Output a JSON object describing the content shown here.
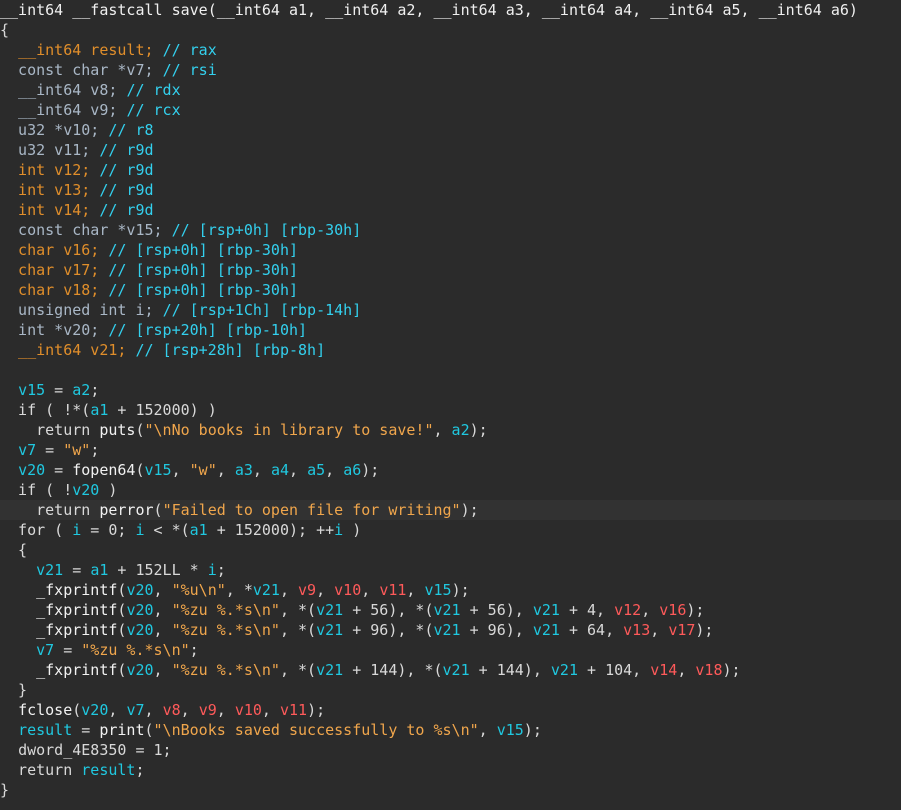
{
  "colors": {
    "background": "#2b2b2b",
    "current_line": "#323232",
    "type_orange": "#e08e2b",
    "identifier_cyan": "#20c8e0",
    "string_orange": "#f0a64c",
    "red_variable": "#ff5a5a",
    "default_text": "#d9d9d9"
  },
  "lines": [
    [
      {
        "t": "__int64 __fastcall save(__int64 a1, __int64 a2, __int64 a3, __int64 a4, __int64 a5, __int64 a6)",
        "c": "sig"
      }
    ],
    [
      {
        "t": "{",
        "c": "plain"
      }
    ],
    [
      {
        "t": "  ",
        "c": "plain"
      },
      {
        "t": "__int64",
        "c": "type"
      },
      {
        "t": " result; ",
        "c": "type"
      },
      {
        "t": "// rax",
        "c": "comment"
      }
    ],
    [
      {
        "t": "  const char *v7; ",
        "c": "keyword"
      },
      {
        "t": "// rsi",
        "c": "comment"
      }
    ],
    [
      {
        "t": "  __int64 v8; ",
        "c": "keyword"
      },
      {
        "t": "// rdx",
        "c": "comment"
      }
    ],
    [
      {
        "t": "  __int64 v9; ",
        "c": "keyword"
      },
      {
        "t": "// rcx",
        "c": "comment"
      }
    ],
    [
      {
        "t": "  u32 *v10; ",
        "c": "keyword"
      },
      {
        "t": "// r8",
        "c": "comment"
      }
    ],
    [
      {
        "t": "  u32 v11; ",
        "c": "keyword"
      },
      {
        "t": "// r9d",
        "c": "comment"
      }
    ],
    [
      {
        "t": "  int v12; ",
        "c": "type"
      },
      {
        "t": "// r9d",
        "c": "comment"
      }
    ],
    [
      {
        "t": "  int v13; ",
        "c": "type"
      },
      {
        "t": "// r9d",
        "c": "comment"
      }
    ],
    [
      {
        "t": "  int v14; ",
        "c": "type"
      },
      {
        "t": "// r9d",
        "c": "comment"
      }
    ],
    [
      {
        "t": "  const char *v15; ",
        "c": "keyword"
      },
      {
        "t": "// [rsp+0h] [rbp-30h]",
        "c": "comment"
      }
    ],
    [
      {
        "t": "  char v16; ",
        "c": "type"
      },
      {
        "t": "// [rsp+0h] [rbp-30h]",
        "c": "comment"
      }
    ],
    [
      {
        "t": "  char v17; ",
        "c": "type"
      },
      {
        "t": "// [rsp+0h] [rbp-30h]",
        "c": "comment"
      }
    ],
    [
      {
        "t": "  char v18; ",
        "c": "type"
      },
      {
        "t": "// [rsp+0h] [rbp-30h]",
        "c": "comment"
      }
    ],
    [
      {
        "t": "  unsigned int i; ",
        "c": "keyword"
      },
      {
        "t": "// [rsp+1Ch] [rbp-14h]",
        "c": "comment"
      }
    ],
    [
      {
        "t": "  int *v20; ",
        "c": "keyword"
      },
      {
        "t": "// [rsp+20h] [rbp-10h]",
        "c": "comment"
      }
    ],
    [
      {
        "t": "  __int64 v21; ",
        "c": "type"
      },
      {
        "t": "// [rsp+28h] [rbp-8h]",
        "c": "comment"
      }
    ],
    [
      {
        "t": "",
        "c": "plain"
      }
    ],
    [
      {
        "t": "  ",
        "c": "plain"
      },
      {
        "t": "v15",
        "c": "ident"
      },
      {
        "t": " = ",
        "c": "plain"
      },
      {
        "t": "a2",
        "c": "ident"
      },
      {
        "t": ";",
        "c": "plain"
      }
    ],
    [
      {
        "t": "  if ( !*(",
        "c": "plain"
      },
      {
        "t": "a1",
        "c": "ident"
      },
      {
        "t": " + 152000) )",
        "c": "plain"
      }
    ],
    [
      {
        "t": "    return ",
        "c": "plain"
      },
      {
        "t": "puts",
        "c": "func"
      },
      {
        "t": "(",
        "c": "plain"
      },
      {
        "t": "\"\\nNo books in library to save!\"",
        "c": "string"
      },
      {
        "t": ", ",
        "c": "plain"
      },
      {
        "t": "a2",
        "c": "ident"
      },
      {
        "t": ");",
        "c": "plain"
      }
    ],
    [
      {
        "t": "  ",
        "c": "plain"
      },
      {
        "t": "v7",
        "c": "ident"
      },
      {
        "t": " = ",
        "c": "plain"
      },
      {
        "t": "\"w\"",
        "c": "string"
      },
      {
        "t": ";",
        "c": "plain"
      }
    ],
    [
      {
        "t": "  ",
        "c": "plain"
      },
      {
        "t": "v20",
        "c": "ident"
      },
      {
        "t": " = ",
        "c": "plain"
      },
      {
        "t": "fopen64",
        "c": "func"
      },
      {
        "t": "(",
        "c": "plain"
      },
      {
        "t": "v15",
        "c": "ident"
      },
      {
        "t": ", ",
        "c": "plain"
      },
      {
        "t": "\"w\"",
        "c": "string"
      },
      {
        "t": ", ",
        "c": "plain"
      },
      {
        "t": "a3",
        "c": "ident"
      },
      {
        "t": ", ",
        "c": "plain"
      },
      {
        "t": "a4",
        "c": "ident"
      },
      {
        "t": ", ",
        "c": "plain"
      },
      {
        "t": "a5",
        "c": "ident"
      },
      {
        "t": ", ",
        "c": "plain"
      },
      {
        "t": "a6",
        "c": "ident"
      },
      {
        "t": ");",
        "c": "plain"
      }
    ],
    [
      {
        "t": "  if ( !",
        "c": "plain"
      },
      {
        "t": "v20",
        "c": "ident"
      },
      {
        "t": " )",
        "c": "plain"
      }
    ],
    [
      {
        "t": "    return ",
        "c": "plain"
      },
      {
        "t": "perror",
        "c": "func"
      },
      {
        "t": "(",
        "c": "plain"
      },
      {
        "t": "\"Failed to open file for writing\"",
        "c": "string"
      },
      {
        "t": ");",
        "c": "plain"
      }
    ],
    [
      {
        "t": "  for ( ",
        "c": "plain"
      },
      {
        "t": "i",
        "c": "ident"
      },
      {
        "t": " = 0; ",
        "c": "plain"
      },
      {
        "t": "i",
        "c": "ident"
      },
      {
        "t": " < *(",
        "c": "plain"
      },
      {
        "t": "a1",
        "c": "ident"
      },
      {
        "t": " + 152000); ++",
        "c": "plain"
      },
      {
        "t": "i",
        "c": "ident"
      },
      {
        "t": " )",
        "c": "plain"
      }
    ],
    [
      {
        "t": "  {",
        "c": "plain"
      }
    ],
    [
      {
        "t": "    ",
        "c": "plain"
      },
      {
        "t": "v21",
        "c": "ident"
      },
      {
        "t": " = ",
        "c": "plain"
      },
      {
        "t": "a1",
        "c": "ident"
      },
      {
        "t": " + 152LL * ",
        "c": "plain"
      },
      {
        "t": "i",
        "c": "ident"
      },
      {
        "t": ";",
        "c": "plain"
      }
    ],
    [
      {
        "t": "    ",
        "c": "plain"
      },
      {
        "t": "_fxprintf",
        "c": "func"
      },
      {
        "t": "(",
        "c": "plain"
      },
      {
        "t": "v20",
        "c": "ident"
      },
      {
        "t": ", ",
        "c": "plain"
      },
      {
        "t": "\"%u\\n\"",
        "c": "string"
      },
      {
        "t": ", *",
        "c": "plain"
      },
      {
        "t": "v21",
        "c": "ident"
      },
      {
        "t": ", ",
        "c": "plain"
      },
      {
        "t": "v9",
        "c": "red"
      },
      {
        "t": ", ",
        "c": "plain"
      },
      {
        "t": "v10",
        "c": "red"
      },
      {
        "t": ", ",
        "c": "plain"
      },
      {
        "t": "v11",
        "c": "red"
      },
      {
        "t": ", ",
        "c": "plain"
      },
      {
        "t": "v15",
        "c": "ident"
      },
      {
        "t": ");",
        "c": "plain"
      }
    ],
    [
      {
        "t": "    ",
        "c": "plain"
      },
      {
        "t": "_fxprintf",
        "c": "func"
      },
      {
        "t": "(",
        "c": "plain"
      },
      {
        "t": "v20",
        "c": "ident"
      },
      {
        "t": ", ",
        "c": "plain"
      },
      {
        "t": "\"%zu %.*s\\n\"",
        "c": "string"
      },
      {
        "t": ", *(",
        "c": "plain"
      },
      {
        "t": "v21",
        "c": "ident"
      },
      {
        "t": " + 56), *(",
        "c": "plain"
      },
      {
        "t": "v21",
        "c": "ident"
      },
      {
        "t": " + 56), ",
        "c": "plain"
      },
      {
        "t": "v21",
        "c": "ident"
      },
      {
        "t": " + 4, ",
        "c": "plain"
      },
      {
        "t": "v12",
        "c": "red"
      },
      {
        "t": ", ",
        "c": "plain"
      },
      {
        "t": "v16",
        "c": "red"
      },
      {
        "t": ");",
        "c": "plain"
      }
    ],
    [
      {
        "t": "    ",
        "c": "plain"
      },
      {
        "t": "_fxprintf",
        "c": "func"
      },
      {
        "t": "(",
        "c": "plain"
      },
      {
        "t": "v20",
        "c": "ident"
      },
      {
        "t": ", ",
        "c": "plain"
      },
      {
        "t": "\"%zu %.*s\\n\"",
        "c": "string"
      },
      {
        "t": ", *(",
        "c": "plain"
      },
      {
        "t": "v21",
        "c": "ident"
      },
      {
        "t": " + 96), *(",
        "c": "plain"
      },
      {
        "t": "v21",
        "c": "ident"
      },
      {
        "t": " + 96), ",
        "c": "plain"
      },
      {
        "t": "v21",
        "c": "ident"
      },
      {
        "t": " + 64, ",
        "c": "plain"
      },
      {
        "t": "v13",
        "c": "red"
      },
      {
        "t": ", ",
        "c": "plain"
      },
      {
        "t": "v17",
        "c": "red"
      },
      {
        "t": ");",
        "c": "plain"
      }
    ],
    [
      {
        "t": "    ",
        "c": "plain"
      },
      {
        "t": "v7",
        "c": "ident"
      },
      {
        "t": " = ",
        "c": "plain"
      },
      {
        "t": "\"%zu %.*s\\n\"",
        "c": "string"
      },
      {
        "t": ";",
        "c": "plain"
      }
    ],
    [
      {
        "t": "    ",
        "c": "plain"
      },
      {
        "t": "_fxprintf",
        "c": "func"
      },
      {
        "t": "(",
        "c": "plain"
      },
      {
        "t": "v20",
        "c": "ident"
      },
      {
        "t": ", ",
        "c": "plain"
      },
      {
        "t": "\"%zu %.*s\\n\"",
        "c": "string"
      },
      {
        "t": ", *(",
        "c": "plain"
      },
      {
        "t": "v21",
        "c": "ident"
      },
      {
        "t": " + 144), *(",
        "c": "plain"
      },
      {
        "t": "v21",
        "c": "ident"
      },
      {
        "t": " + 144), ",
        "c": "plain"
      },
      {
        "t": "v21",
        "c": "ident"
      },
      {
        "t": " + 104, ",
        "c": "plain"
      },
      {
        "t": "v14",
        "c": "red"
      },
      {
        "t": ", ",
        "c": "plain"
      },
      {
        "t": "v18",
        "c": "red"
      },
      {
        "t": ");",
        "c": "plain"
      }
    ],
    [
      {
        "t": "  }",
        "c": "plain"
      }
    ],
    [
      {
        "t": "  ",
        "c": "plain"
      },
      {
        "t": "fclose",
        "c": "func"
      },
      {
        "t": "(",
        "c": "plain"
      },
      {
        "t": "v20",
        "c": "ident"
      },
      {
        "t": ", ",
        "c": "plain"
      },
      {
        "t": "v7",
        "c": "ident"
      },
      {
        "t": ", ",
        "c": "plain"
      },
      {
        "t": "v8",
        "c": "red"
      },
      {
        "t": ", ",
        "c": "plain"
      },
      {
        "t": "v9",
        "c": "red"
      },
      {
        "t": ", ",
        "c": "plain"
      },
      {
        "t": "v10",
        "c": "red"
      },
      {
        "t": ", ",
        "c": "plain"
      },
      {
        "t": "v11",
        "c": "red"
      },
      {
        "t": ");",
        "c": "plain"
      }
    ],
    [
      {
        "t": "  ",
        "c": "plain"
      },
      {
        "t": "result",
        "c": "ident"
      },
      {
        "t": " = ",
        "c": "plain"
      },
      {
        "t": "print",
        "c": "func"
      },
      {
        "t": "(",
        "c": "plain"
      },
      {
        "t": "\"\\nBooks saved successfully to %s\\n\"",
        "c": "string"
      },
      {
        "t": ", ",
        "c": "plain"
      },
      {
        "t": "v15",
        "c": "ident"
      },
      {
        "t": ");",
        "c": "plain"
      }
    ],
    [
      {
        "t": "  ",
        "c": "plain"
      },
      {
        "t": "dword_4E8350",
        "c": "plain"
      },
      {
        "t": " = 1;",
        "c": "plain"
      }
    ],
    [
      {
        "t": "  return ",
        "c": "plain"
      },
      {
        "t": "result",
        "c": "ident"
      },
      {
        "t": ";",
        "c": "plain"
      }
    ],
    [
      {
        "t": "}",
        "c": "plain"
      }
    ]
  ],
  "current_line_index": 25
}
